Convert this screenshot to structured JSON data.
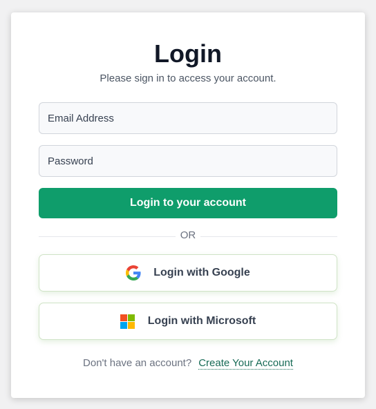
{
  "header": {
    "title": "Login",
    "subtitle": "Please sign in to access your account."
  },
  "form": {
    "email_placeholder": "Email Address",
    "password_placeholder": "Password",
    "submit_label": "Login to your account"
  },
  "divider": {
    "label": "OR"
  },
  "social": {
    "google_label": "Login with Google",
    "google_icon": "google-icon",
    "microsoft_label": "Login with Microsoft",
    "microsoft_icon": "microsoft-icon"
  },
  "footer": {
    "prompt": "Don't have an account?",
    "link_label": "Create Your Account"
  },
  "colors": {
    "primary": "#0f9d6b",
    "link": "#166a55",
    "google_blue": "#4285F4",
    "google_red": "#EA4335",
    "google_yellow": "#FBBC05",
    "google_green": "#34A853",
    "ms_red": "#F25022",
    "ms_green": "#7FBA00",
    "ms_blue": "#00A4EF",
    "ms_yellow": "#FFB900"
  }
}
